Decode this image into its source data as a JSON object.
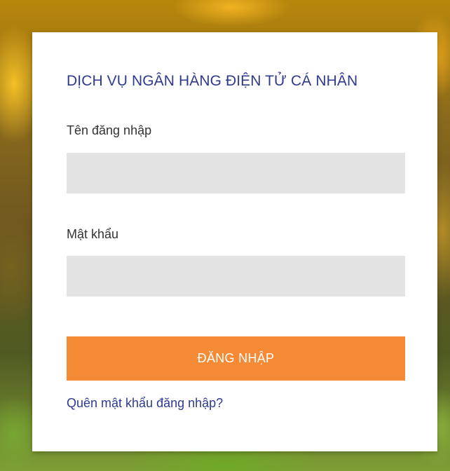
{
  "login": {
    "title": "DỊCH VỤ NGÂN HÀNG ĐIỆN TỬ CÁ NHÂN",
    "username_label": "Tên đăng nhập",
    "username_value": "",
    "password_label": "Mật khẩu",
    "password_value": "",
    "submit_label": "ĐĂNG NHẬP",
    "forgot_label": "Quên mật khẩu đăng nhập?"
  },
  "colors": {
    "title": "#2f3a8f",
    "button": "#f58a34",
    "input_bg": "#e3e3e4",
    "link": "#2f3a8f"
  }
}
